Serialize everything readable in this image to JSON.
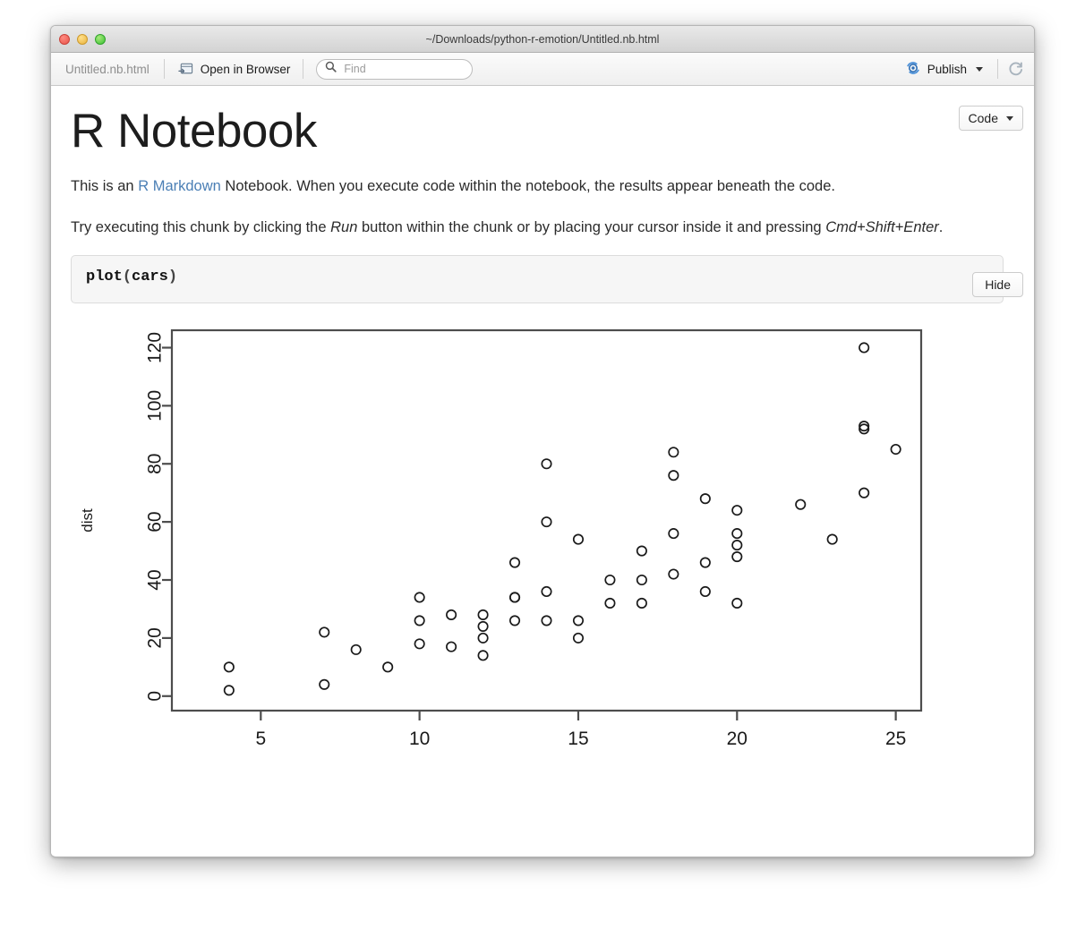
{
  "window": {
    "path_title": "~/Downloads/python-r-emotion/Untitled.nb.html",
    "traffic_lights": [
      "close-red",
      "minimize-yellow",
      "zoom-green"
    ]
  },
  "toolbar": {
    "filename": "Untitled.nb.html",
    "open_in_browser_label": "Open in Browser",
    "open_in_browser_icon": "browser-window-icon",
    "find_placeholder": "Find",
    "find_value": "",
    "find_icon": "search-icon",
    "publish_label": "Publish",
    "publish_icon": "publish-icon",
    "publish_caret_icon": "chevron-down-icon",
    "refresh_icon": "refresh-icon"
  },
  "document": {
    "title": "R Notebook",
    "code_button_label": "Code",
    "code_button_caret_icon": "chevron-down-icon",
    "hide_button_label": "Hide",
    "paragraph1": {
      "before_link": "This is an ",
      "link": "R Markdown",
      "after_link": " Notebook. When you execute code within the notebook, the results appear beneath the code."
    },
    "paragraph2": {
      "part1": "Try executing this chunk by clicking the ",
      "italic1": "Run",
      "part2": " button within the chunk or by placing your cursor inside it and pressing ",
      "italic2": "Cmd+Shift+Enter",
      "part3": "."
    },
    "code_chunk": {
      "func": "plot",
      "open_paren": "(",
      "arg": "cars",
      "close_paren": ")",
      "full": "plot(cars)"
    }
  },
  "chart_data": {
    "type": "scatter",
    "title": "",
    "xlabel": "",
    "ylabel": "dist",
    "xlim": [
      2.2,
      25.8
    ],
    "ylim": [
      -5,
      126
    ],
    "xticks": [
      5,
      10,
      15,
      20,
      25
    ],
    "yticks": [
      0,
      20,
      40,
      60,
      80,
      100,
      120
    ],
    "grid": false,
    "legend": null,
    "marker": "open-circle",
    "x": [
      4,
      4,
      7,
      7,
      8,
      9,
      10,
      10,
      10,
      11,
      11,
      12,
      12,
      12,
      12,
      13,
      13,
      13,
      13,
      14,
      14,
      14,
      14,
      15,
      15,
      15,
      16,
      16,
      17,
      17,
      17,
      18,
      18,
      18,
      18,
      19,
      19,
      19,
      20,
      20,
      20,
      20,
      20,
      22,
      23,
      24,
      24,
      24,
      24,
      25
    ],
    "y": [
      2,
      10,
      4,
      22,
      16,
      10,
      18,
      26,
      34,
      17,
      28,
      14,
      20,
      24,
      28,
      26,
      34,
      34,
      46,
      26,
      36,
      60,
      80,
      20,
      26,
      54,
      32,
      40,
      32,
      40,
      50,
      42,
      56,
      76,
      84,
      36,
      46,
      68,
      32,
      48,
      52,
      56,
      64,
      66,
      54,
      70,
      92,
      93,
      120,
      85
    ]
  }
}
